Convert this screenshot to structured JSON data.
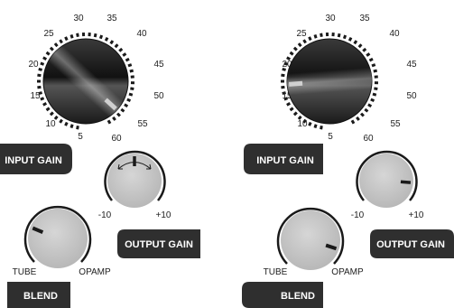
{
  "theme": {
    "label_bg": "#2f2f2f",
    "label_text": "#ffffff",
    "knob_light": "#c8c8c8",
    "knob_dark": "#1c1c1c",
    "ring": "#1a1a1a",
    "indicator": "#d0d0d0"
  },
  "panels": [
    {
      "input_gain": {
        "label": "INPUT GAIN",
        "scale": [
          "5",
          "10",
          "15",
          "20",
          "25",
          "30",
          "35",
          "40",
          "45",
          "50",
          "55",
          "60"
        ],
        "value": 57
      },
      "output_gain": {
        "label": "OUTPUT GAIN",
        "min_label": "-10",
        "max_label": "+10",
        "value": 0,
        "arrows": "double-arrow-icon"
      },
      "blend": {
        "label": "BLEND",
        "min_label": "TUBE",
        "max_label": "OPAMP",
        "value": 0.25
      }
    },
    {
      "input_gain": {
        "label": "INPUT GAIN",
        "scale": [
          "5",
          "10",
          "15",
          "20",
          "25",
          "30",
          "35",
          "40",
          "45",
          "50",
          "55",
          "60"
        ],
        "value": 18
      },
      "output_gain": {
        "label": "OUTPUT GAIN",
        "min_label": "-10",
        "max_label": "+10",
        "value": 7
      },
      "blend": {
        "label": "BLEND",
        "min_label": "TUBE",
        "max_label": "OPAMP",
        "value": 0.9
      }
    }
  ]
}
